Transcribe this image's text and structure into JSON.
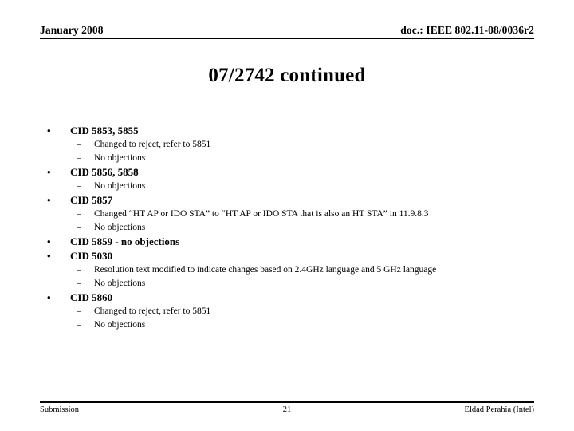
{
  "header": {
    "left": "January 2008",
    "right": "doc.: IEEE 802.11-08/0036r2"
  },
  "title": "07/2742 continued",
  "bullet_glyph": "•",
  "dash_glyph": "–",
  "groups": [
    {
      "heading": "CID 5853, 5855",
      "items": [
        "Changed to reject, refer to 5851",
        "No objections"
      ]
    },
    {
      "heading": "CID 5856, 5858",
      "items": [
        "No objections"
      ]
    },
    {
      "heading": "CID 5857",
      "items": [
        "Changed “HT AP or IDO STA” to “HT AP or IDO STA that is also an HT STA” in 11.9.8.3",
        "No objections"
      ]
    },
    {
      "heading": "CID 5859 - no objections",
      "items": []
    },
    {
      "heading": "CID 5030",
      "items": [
        "Resolution text modified to indicate changes based on 2.4GHz language and 5 GHz language",
        "No objections"
      ]
    },
    {
      "heading": "CID 5860",
      "items": [
        "Changed to reject, refer to 5851",
        "No objections"
      ]
    }
  ],
  "footer": {
    "left": "Submission",
    "page": "21",
    "right": "Eldad Perahia (Intel)"
  }
}
